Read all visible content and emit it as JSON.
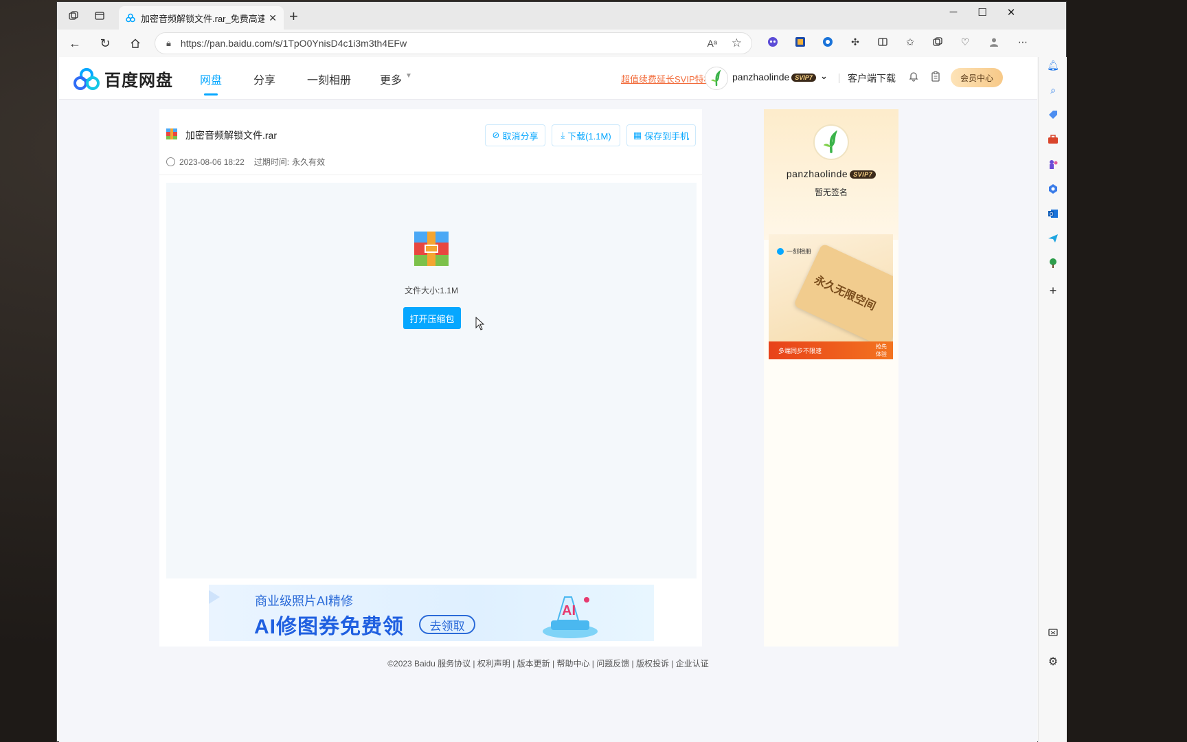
{
  "browser": {
    "tab_title": "加密音频解锁文件.rar_免费高速下",
    "url": "https://pan.baidu.com/s/1TpO0YnisD4c1i3m3th4EFw",
    "window_controls": {
      "minimize": "─",
      "maximize": "☐",
      "close": "✕"
    }
  },
  "header": {
    "logo_text": "百度网盘",
    "nav": [
      "网盘",
      "分享",
      "一刻相册",
      "更多"
    ],
    "svip_link": "超值续费延长SVIP特权",
    "username": "panzhaolinde",
    "vip_level": "SVIP7",
    "client_download": "客户端下载",
    "vip_center": "会员中心"
  },
  "file": {
    "name": "加密音频解锁文件.rar",
    "created": "2023-08-06 18:22",
    "expire_label": "过期时间:",
    "expire_value": "永久有效",
    "size_text": "文件大小:1.1M",
    "open_button": "打开压缩包"
  },
  "actions": {
    "cancel_share": "取消分享",
    "download": "下载(1.1M)",
    "save_phone": "保存到手机"
  },
  "banner": {
    "line1": "商业级照片AI精修",
    "line2": "AI修图券免费领",
    "cta": "去领取"
  },
  "profile": {
    "name": "panzhaolinde",
    "vip_level": "SVIP7",
    "signature": "暂无签名"
  },
  "ad": {
    "brand": "一刻相册",
    "headline": "永久无限空间",
    "strip_text": "多端同步不限速",
    "strip_cta": "抢先体验"
  },
  "footer": "©2023 Baidu  服务协议 | 权利声明 | 版本更新 | 帮助中心 | 问题反馈 | 版权投诉 | 企业认证",
  "colors": {
    "accent": "#06a7ff",
    "svip_link": "#f26b3a"
  }
}
